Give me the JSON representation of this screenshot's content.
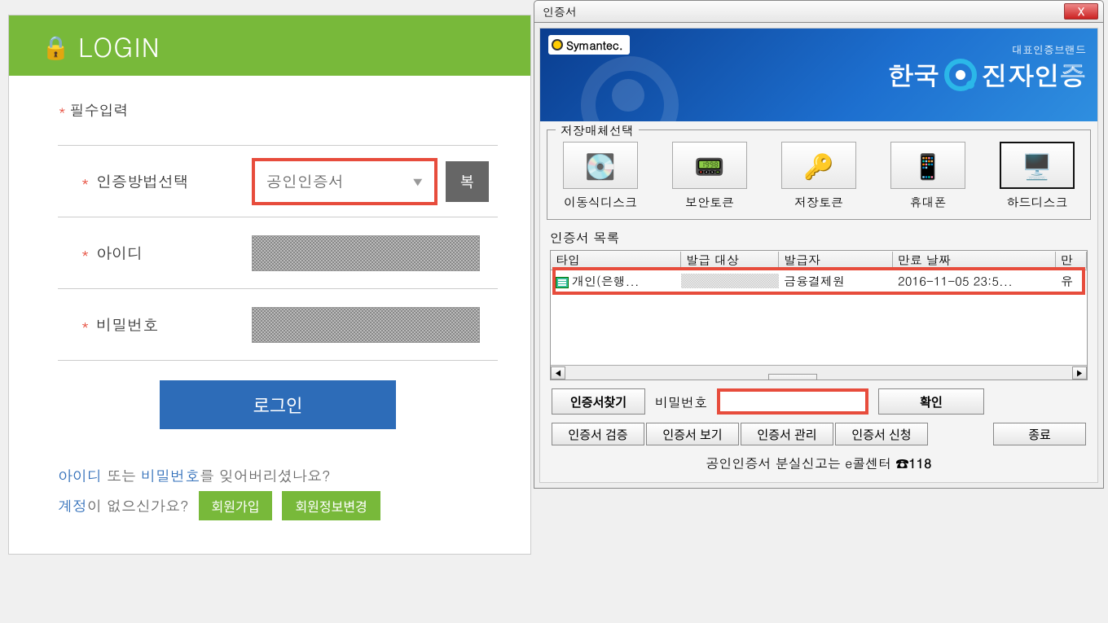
{
  "login": {
    "header_title": "LOGIN",
    "required_note": "필수입력",
    "rows": {
      "method_label": "인증방법선택",
      "method_value": "공인인증서",
      "gray_btn": "복",
      "id_label": "아이디",
      "pw_label": "비밀번호"
    },
    "login_btn": "로그인",
    "forgot_prefix_link1": "아이디",
    "forgot_mid": " 또는 ",
    "forgot_link2": "비밀번호",
    "forgot_suffix": "를 잊어버리셨나요?",
    "account_link": "계정",
    "account_q": "이 없으신가요?",
    "signup_btn": "회원가입",
    "modify_btn": "회원정보변경"
  },
  "cert": {
    "title": "인증서",
    "close_label": "X",
    "brand_tag": "대표인증브랜드",
    "brand_text_left": "한국",
    "brand_text_right": "진자인증",
    "symantec": "Symantec.",
    "storage_legend": "저장매체선택",
    "storage": [
      {
        "label": "이동식디스크",
        "icon": "💽"
      },
      {
        "label": "보안토큰",
        "icon": "📟"
      },
      {
        "label": "저장토큰",
        "icon": "🔑"
      },
      {
        "label": "휴대폰",
        "icon": "📱"
      },
      {
        "label": "하드디스크",
        "icon": "🖥️"
      }
    ],
    "list_label": "인증서 목록",
    "columns": {
      "c0": "타입",
      "c1": "발급 대상",
      "c2": "발급자",
      "c3": "만료 날짜",
      "c4": "만"
    },
    "row": {
      "c0": "개인(은행...",
      "c2": "금융결제원",
      "c3": "2016-11-05 23:5...",
      "c4": "유"
    },
    "find_btn": "인증서찾기",
    "pw_label": "비밀번호",
    "confirm_btn": "확인",
    "bottom": {
      "b0": "인증서 검증",
      "b1": "인증서 보기",
      "b2": "인증서 관리",
      "b3": "인증서 신청",
      "b4": "종료"
    },
    "footer_a": "공인인증서 분실신고는  e콜센터 ",
    "footer_b": "☎118"
  }
}
